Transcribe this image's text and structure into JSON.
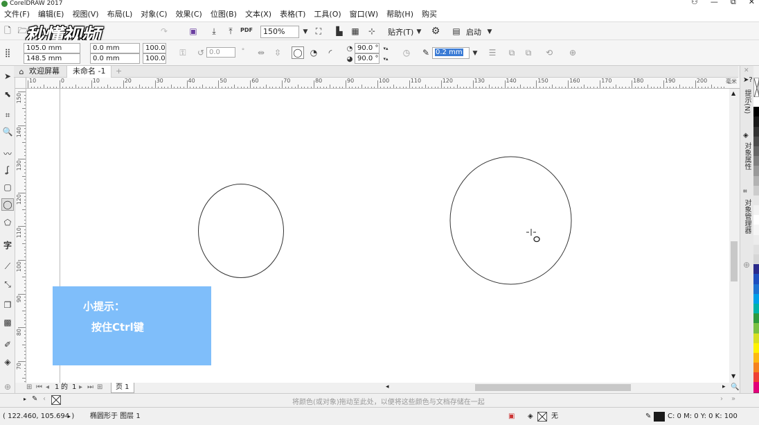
{
  "app": {
    "title": "CorelDRAW 2017"
  },
  "window_controls": {
    "minimize": "—",
    "restore": "⧉",
    "close": "✕"
  },
  "menu": [
    "文件(F)",
    "编辑(E)",
    "视图(V)",
    "布局(L)",
    "对象(C)",
    "效果(C)",
    "位图(B)",
    "文本(X)",
    "表格(T)",
    "工具(O)",
    "窗口(W)",
    "帮助(H)",
    "购买"
  ],
  "toolbar": {
    "zoom": "150%",
    "snap_label": "贴齐(T)",
    "launch_label": "启动",
    "pdf": "PDF"
  },
  "property_bar": {
    "x": "105.0 mm",
    "y": "148.5 mm",
    "w": "0.0 mm",
    "h": "0.0 mm",
    "scale_w": "100.0",
    "scale_h": "100.0",
    "rotation": "0.0",
    "start_angle": "90.0 °",
    "end_angle": "90.0 °",
    "outline_width": "0.2 mm"
  },
  "doc_tabs": {
    "welcome": "欢迎屏幕",
    "doc": "未命名 -1",
    "add": "+"
  },
  "ruler": {
    "h_labels": [
      "10",
      "0",
      "10",
      "20",
      "30",
      "40",
      "50",
      "60",
      "70",
      "80",
      "90",
      "100",
      "110",
      "120",
      "130",
      "140",
      "150",
      "160",
      "170",
      "180",
      "190",
      "200"
    ],
    "unit": "毫米",
    "v_labels": [
      "150",
      "140",
      "130",
      "120",
      "110",
      "100",
      "90",
      "80",
      "70"
    ]
  },
  "pager": {
    "page_current": "1",
    "of": "的",
    "page_total": "1",
    "page_tab": "页 1"
  },
  "dockers": {
    "hints": "提示(N)",
    "properties": "对象属性",
    "manager": "对象管理器"
  },
  "colorbar": {
    "hint": "将颜色(或对象)拖动至此处，以便将这些颜色与文档存储在一起"
  },
  "status": {
    "coords": "( 122.460, 105.694 )",
    "object": "椭圆形于 图层 1",
    "fill": "无",
    "outline": "C: 0 M: 0 Y: 0 K: 100"
  },
  "tip": {
    "title": "小提示：",
    "body": "按住Ctrl键"
  },
  "watermark": {
    "text": "秒懂视频"
  },
  "palette_colors": [
    "#ffffff",
    "#000000",
    "#1a1a1a",
    "#333333",
    "#4d4d4d",
    "#666666",
    "#808080",
    "#999999",
    "#b3b3b3",
    "#cccccc",
    "#e6e6e6",
    "#f2f2f2",
    "#ffffff",
    "#f5f5f5",
    "#ececec",
    "#e0e0e0",
    "#d6d6d6",
    "#2b2b8c",
    "#1f4fbf",
    "#1e73d2",
    "#00a0e9",
    "#00b2a9",
    "#2e9a3e",
    "#7ac143",
    "#d7df23",
    "#fff200",
    "#fdb913",
    "#f58220",
    "#ef4136",
    "#e2007a",
    "#9e1f63"
  ],
  "colors": {
    "tip_bg": "#7fbefa",
    "accent_sel": "#3a7bd5"
  }
}
